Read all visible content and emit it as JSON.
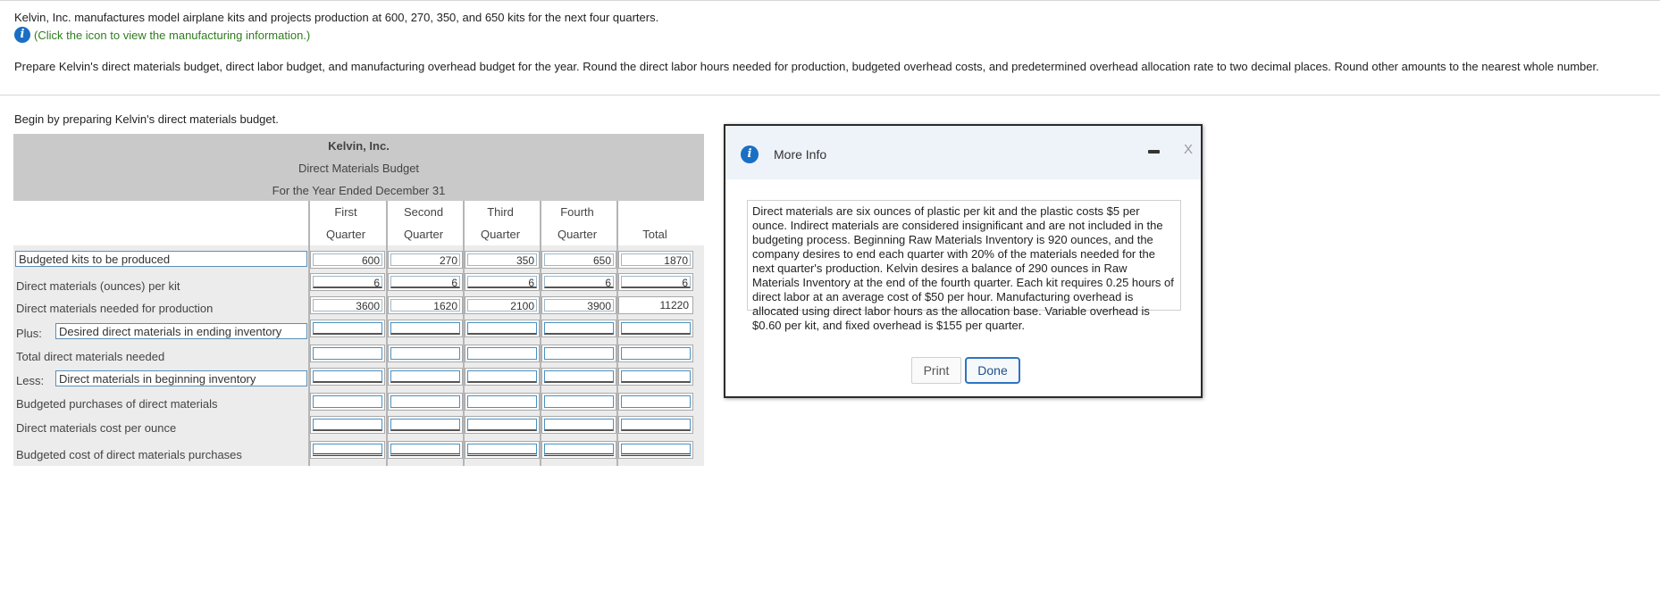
{
  "intro": "Kelvin, Inc. manufactures model airplane kits and projects production at 600, 270, 350, and 650 kits for the next four quarters.",
  "hint": "(Click the icon to view the manufacturing information.)",
  "instructions": "Prepare Kelvin's direct materials budget, direct labor budget, and manufacturing overhead budget for the year. Round the direct labor hours needed for production, budgeted overhead costs, and predetermined overhead allocation rate to two decimal places. Round other amounts to the nearest whole number.",
  "begin_prompt": "Begin by preparing Kelvin's direct materials budget.",
  "budget": {
    "company": "Kelvin, Inc.",
    "title": "Direct Materials Budget",
    "period": "For the Year Ended December 31",
    "col_headers": [
      {
        "line1": "First",
        "line2": "Quarter"
      },
      {
        "line1": "Second",
        "line2": "Quarter"
      },
      {
        "line1": "Third",
        "line2": "Quarter"
      },
      {
        "line1": "Fourth",
        "line2": "Quarter"
      },
      {
        "line1": "",
        "line2": "Total"
      }
    ],
    "rows": [
      {
        "prefix": "",
        "label": "Budgeted kits to be produced",
        "values": [
          "600",
          "270",
          "350",
          "650",
          "1870"
        ]
      },
      {
        "prefix": "",
        "label": "Direct materials (ounces) per kit",
        "values": [
          "6",
          "6",
          "6",
          "6",
          "6"
        ]
      },
      {
        "prefix": "",
        "label": "Direct materials needed for production",
        "values": [
          "3600",
          "1620",
          "2100",
          "3900",
          "11220"
        ]
      },
      {
        "prefix": "Plus:",
        "label": "Desired direct materials in ending inventory",
        "values": [
          "",
          "",
          "",
          "",
          ""
        ]
      },
      {
        "prefix": "",
        "label": "Total direct materials needed",
        "values": [
          "",
          "",
          "",
          "",
          ""
        ]
      },
      {
        "prefix": "Less:",
        "label": "Direct materials in beginning inventory",
        "values": [
          "",
          "",
          "",
          "",
          ""
        ]
      },
      {
        "prefix": "",
        "label": "Budgeted purchases of direct materials",
        "values": [
          "",
          "",
          "",
          "",
          ""
        ]
      },
      {
        "prefix": "",
        "label": "Direct materials cost per ounce",
        "values": [
          "",
          "",
          "",
          "",
          ""
        ]
      },
      {
        "prefix": "",
        "label": "Budgeted cost of direct materials purchases",
        "values": [
          "",
          "",
          "",
          "",
          ""
        ]
      }
    ]
  },
  "modal": {
    "title": "More Info",
    "close_glyph": "X",
    "text": "Direct materials are six ounces of plastic per kit and the plastic costs $5 per ounce. Indirect materials are considered insignificant and are not included in the budgeting process. Beginning Raw Materials Inventory is 920 ounces, and the company desires to end each quarter with 20% of the materials needed for the next quarter's production. Kelvin desires a balance of 290 ounces in Raw Materials Inventory at the end of the fourth quarter. Each kit requires 0.25 hours of direct labor at an average cost of $50 per hour. Manufacturing overhead is allocated using direct labor hours as the allocation base. Variable overhead is $0.60 per kit, and fixed overhead is $155 per quarter.",
    "print_label": "Print",
    "done_label": "Done"
  },
  "icons": {
    "info": "info-icon",
    "minimize": "minimize-icon",
    "close": "close-icon"
  },
  "colors": {
    "info_blue": "#1a6fc4",
    "hint_green": "#2f7d1e",
    "header_gray": "#c9c9c9",
    "done_border": "#2f74c0"
  }
}
